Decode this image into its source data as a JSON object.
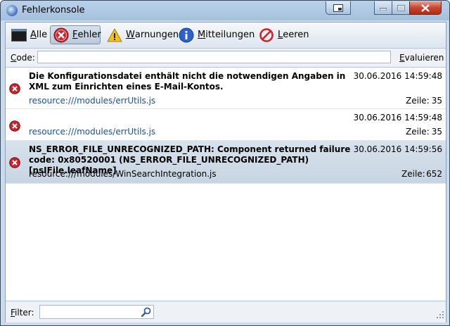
{
  "window": {
    "title": "Fehlerkonsole"
  },
  "toolbar": {
    "buttons": [
      {
        "key": "A",
        "rest": "lle",
        "icon": "console-icon"
      },
      {
        "key": "F",
        "rest": "ehler",
        "icon": "error-icon",
        "active": true
      },
      {
        "key": "W",
        "rest": "arnungen",
        "icon": "warning-icon"
      },
      {
        "key": "M",
        "rest": "itteilungen",
        "icon": "info-icon"
      },
      {
        "key": "L",
        "rest": "eeren",
        "icon": "clear-icon"
      }
    ]
  },
  "codebar": {
    "label_key": "C",
    "label_rest": "ode:",
    "value": "",
    "eval_key": "E",
    "eval_rest": "valuieren"
  },
  "entries": [
    {
      "message": "Die Konfigurationsdatei enthält nicht die notwendigen Angaben in XML zum Einrichten eines E-Mail-Kontos.",
      "timestamp": "30.06.2016 14:59:48",
      "source": "resource:///modules/errUtils.js",
      "line_label": "Zeile:",
      "line": "35"
    },
    {
      "message": "",
      "timestamp": "30.06.2016 14:59:48",
      "source": "resource:///modules/errUtils.js",
      "line_label": "Zeile:",
      "line": "35"
    },
    {
      "message": "NS_ERROR_FILE_UNRECOGNIZED_PATH: Component returned failure code: 0x80520001 (NS_ERROR_FILE_UNRECOGNIZED_PATH) [nsIFile.leafName]",
      "timestamp": "30.06.2016 14:59:56",
      "source": "resource:///modules/WinSearchIntegration.js",
      "line_label": "Zeile:",
      "line": "652"
    }
  ],
  "filterbar": {
    "label_key": "F",
    "label_rest": "ilter:",
    "value": ""
  }
}
